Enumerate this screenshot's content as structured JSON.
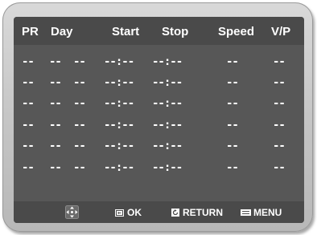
{
  "columns": {
    "pr": "PR",
    "day": "Day",
    "start": "Start",
    "stop": "Stop",
    "speed": "Speed",
    "vp": "V/P"
  },
  "rows": [
    {
      "pr": "--",
      "day1": "--",
      "day2": "--",
      "start": "--:--",
      "stop": "--:--",
      "speed": "--",
      "vp": "--"
    },
    {
      "pr": "--",
      "day1": "--",
      "day2": "--",
      "start": "--:--",
      "stop": "--:--",
      "speed": "--",
      "vp": "--"
    },
    {
      "pr": "--",
      "day1": "--",
      "day2": "--",
      "start": "--:--",
      "stop": "--:--",
      "speed": "--",
      "vp": "--"
    },
    {
      "pr": "--",
      "day1": "--",
      "day2": "--",
      "start": "--:--",
      "stop": "--:--",
      "speed": "--",
      "vp": "--"
    },
    {
      "pr": "--",
      "day1": "--",
      "day2": "--",
      "start": "--:--",
      "stop": "--:--",
      "speed": "--",
      "vp": "--"
    },
    {
      "pr": "--",
      "day1": "--",
      "day2": "--",
      "start": "--:--",
      "stop": "--:--",
      "speed": "--",
      "vp": "--"
    }
  ],
  "footer": {
    "move_icon": "four-way-arrow-icon",
    "ok_label": "OK",
    "ok_icon": "enter-icon",
    "return_label": "RETURN",
    "return_icon": "return-arrow-icon",
    "menu_label": "MENU",
    "menu_icon": "menu-icon"
  },
  "colors": {
    "screen": "#575757",
    "bars": "#4a4a4a",
    "frame": "#c8c8c8",
    "text": "#ffffff"
  }
}
